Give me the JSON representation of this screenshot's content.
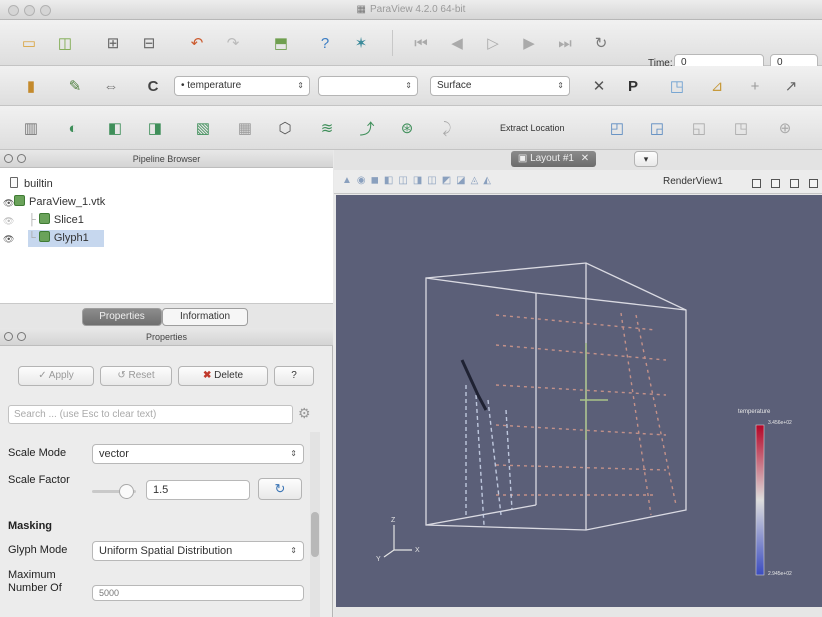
{
  "window": {
    "title": "ParaView 4.2.0 64-bit"
  },
  "toolbar1": {
    "time_label": "Time:",
    "time_value": "0",
    "timestep_value": "0"
  },
  "toolbar2": {
    "color_by": "temperature",
    "component": "",
    "representation": "Surface"
  },
  "toolbar3": {
    "extract_location_label": "Extract Location"
  },
  "pipeline": {
    "title": "Pipeline Browser",
    "items": [
      {
        "label": "builtin"
      },
      {
        "label": "ParaView_1.vtk"
      },
      {
        "label": "Slice1"
      },
      {
        "label": "Glyph1"
      }
    ]
  },
  "tabs": {
    "properties": "Properties",
    "information": "Information"
  },
  "properties": {
    "title": "Properties",
    "apply": "Apply",
    "reset": "Reset",
    "delete": "Delete",
    "help": "?",
    "search_placeholder": "Search ... (use Esc to clear text)",
    "scale_mode_label": "Scale Mode",
    "scale_mode_value": "vector",
    "scale_factor_label": "Scale Factor",
    "scale_factor_value": "1.5",
    "masking_heading": "Masking",
    "glyph_mode_label": "Glyph Mode",
    "glyph_mode_value": "Uniform Spatial Distribution",
    "max_points_label_1": "Maximum",
    "max_points_label_2": "Number Of",
    "max_points_value": "5000"
  },
  "view": {
    "tab_label": "Layout #1",
    "render_view_label": "RenderView1",
    "background_color": "#5b5f78",
    "colorbar": {
      "title": "temperature",
      "top_label": "3.456e+02",
      "bottom_label": "2.945e+02"
    }
  },
  "colors": {
    "accent": "#c6d7ee",
    "glyph_warm": "#d69a8c",
    "glyph_cool": "#b5c4e0"
  }
}
